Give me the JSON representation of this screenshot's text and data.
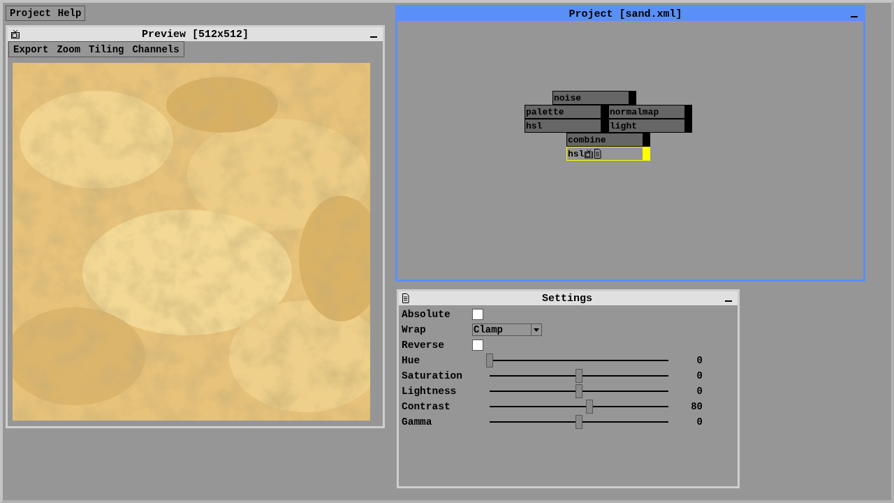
{
  "menu_bar": [
    "Project",
    "Help"
  ],
  "preview_window": {
    "title": "Preview [512x512]",
    "active": false,
    "menu": [
      "Export",
      "Zoom",
      "Tiling",
      "Channels"
    ]
  },
  "project_window": {
    "title": "Project [sand.xml]",
    "active": true,
    "nodes": [
      {
        "label": "noise",
        "selected": false,
        "previewed": false,
        "edited": false
      },
      {
        "label": "palette",
        "selected": false,
        "previewed": false,
        "edited": false
      },
      {
        "label": "normalmap",
        "selected": false,
        "previewed": false,
        "edited": false
      },
      {
        "label": "hsl",
        "selected": false,
        "previewed": false,
        "edited": false
      },
      {
        "label": "light",
        "selected": false,
        "previewed": false,
        "edited": false
      },
      {
        "label": "combine",
        "selected": false,
        "previewed": false,
        "edited": false
      },
      {
        "label": "hsl",
        "selected": true,
        "previewed": true,
        "edited": true
      }
    ]
  },
  "settings_window": {
    "title": "Settings",
    "active": false,
    "rows": [
      {
        "kind": "checkbox",
        "label": "Absolute",
        "checked": false
      },
      {
        "kind": "dropdown",
        "label": "Wrap",
        "value": "Clamp"
      },
      {
        "kind": "checkbox",
        "label": "Reverse",
        "checked": false
      },
      {
        "kind": "slider",
        "label": "Hue",
        "level": 0,
        "reading": "0"
      },
      {
        "kind": "slider",
        "label": "Saturation",
        "level": 0.5,
        "reading": "0"
      },
      {
        "kind": "slider",
        "label": "Lightness",
        "level": 0.5,
        "reading": "0"
      },
      {
        "kind": "slider",
        "label": "Contrast",
        "level": 0.56,
        "reading": "80"
      },
      {
        "kind": "slider",
        "label": "Gamma",
        "level": 0.5,
        "reading": "0"
      }
    ]
  }
}
